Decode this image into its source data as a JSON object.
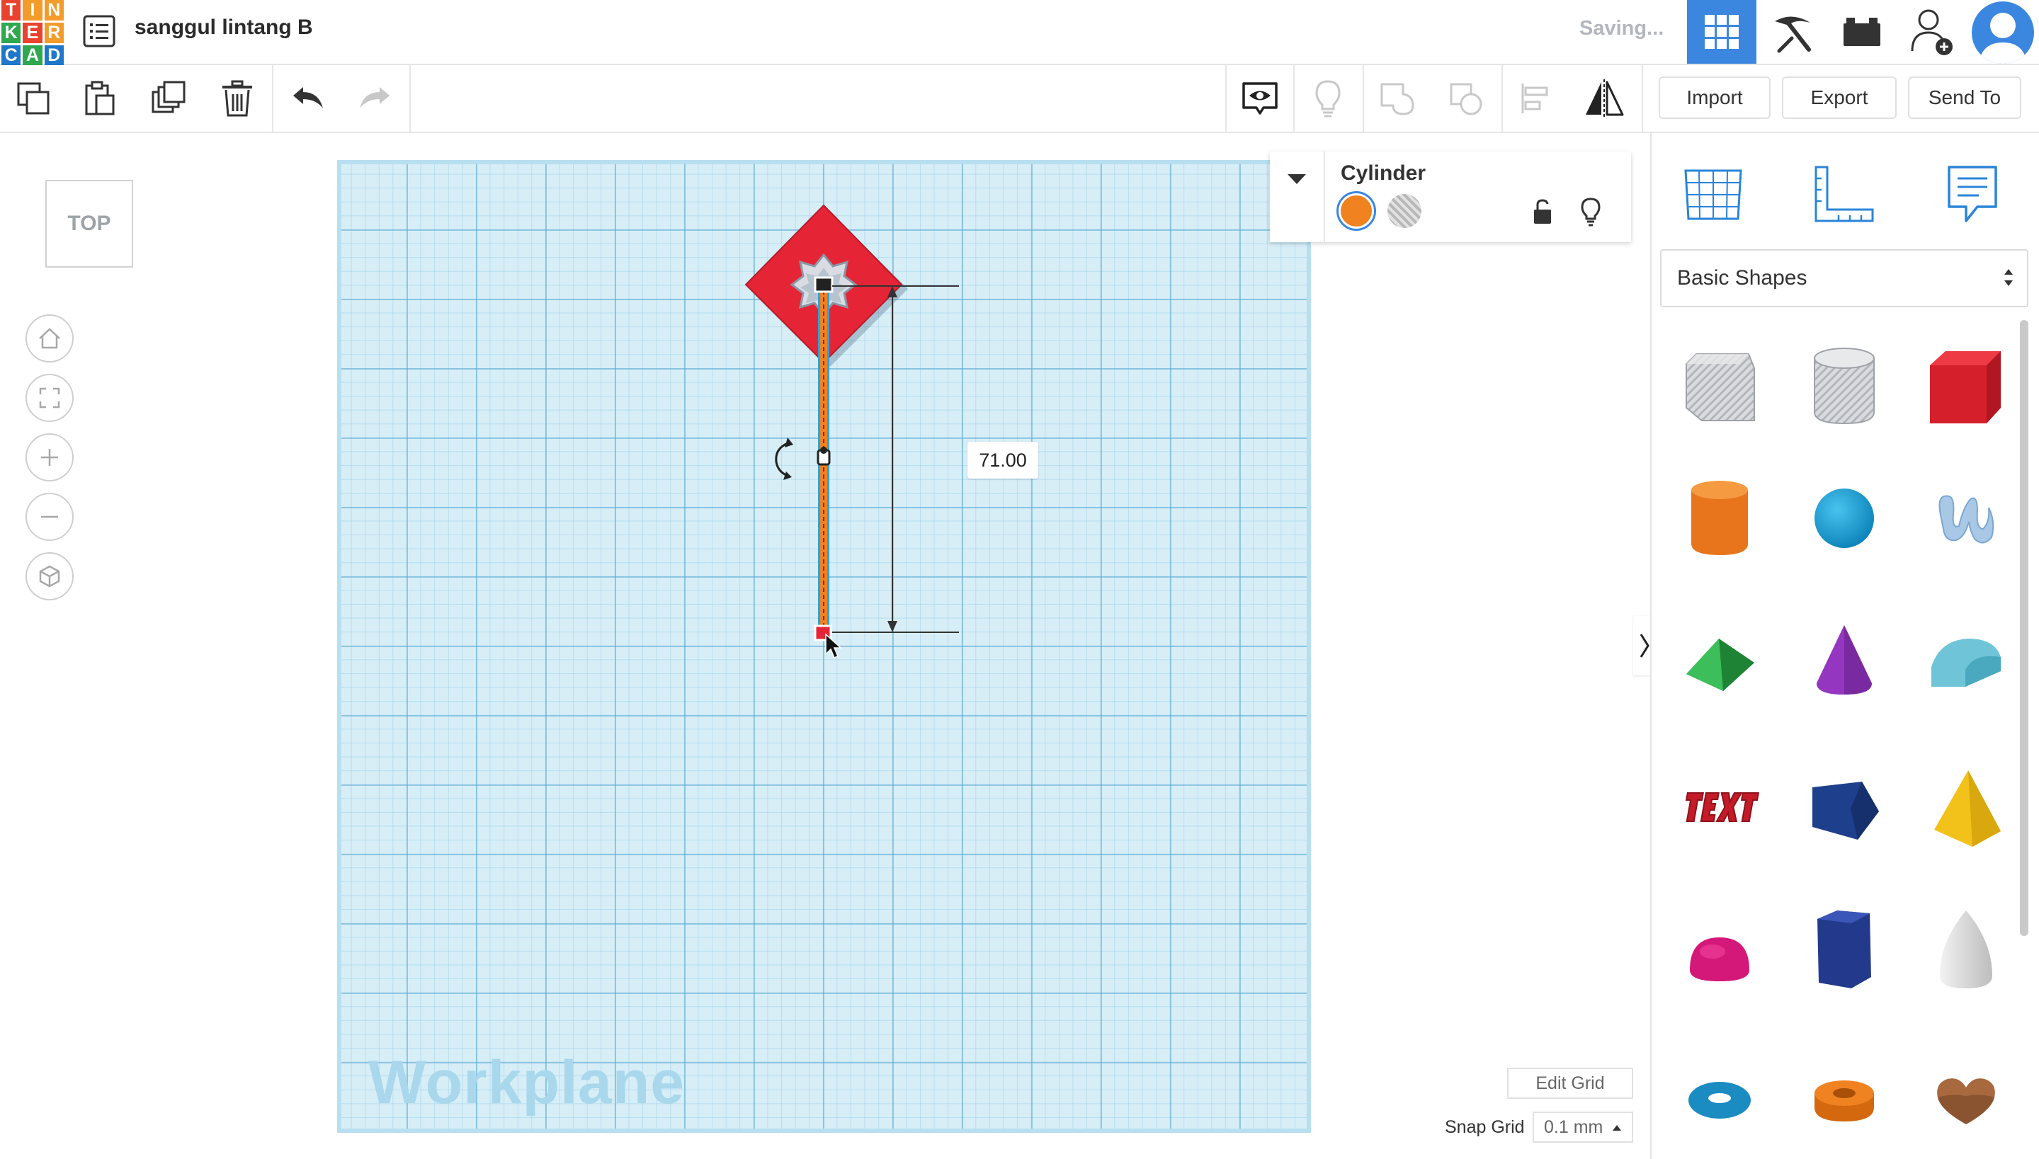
{
  "app": {
    "logo_letters": [
      "T",
      "I",
      "N",
      "K",
      "E",
      "R",
      "C",
      "A",
      "D"
    ],
    "project_title": "sanggul lintang B",
    "save_status": "Saving..."
  },
  "header_icons": [
    "grid-view-icon",
    "pickaxe-icon",
    "brick-icon",
    "add-user-icon",
    "avatar-icon"
  ],
  "toolbar": {
    "import_label": "Import",
    "export_label": "Export",
    "send_to_label": "Send To"
  },
  "view": {
    "cube_label": "TOP"
  },
  "workplane": {
    "label": "Workplane",
    "dimension_value": "71.00"
  },
  "inspector": {
    "shape_name": "Cylinder",
    "solid_color": "#f0821f"
  },
  "grid": {
    "edit_grid_label": "Edit Grid",
    "snap_label": "Snap Grid",
    "snap_value": "0.1 mm"
  },
  "shapes_panel": {
    "category": "Basic Shapes"
  },
  "colors": {
    "accent": "#3b87e0",
    "star_red": "#e52436",
    "cylinder_orange": "#f0821f"
  }
}
